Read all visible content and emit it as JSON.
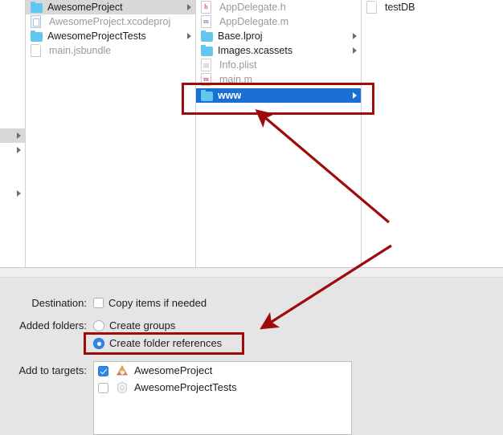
{
  "browser": {
    "columns": [
      {
        "name": "column-0",
        "rows": [
          {
            "label": "",
            "icon": "none",
            "selected": "gray",
            "has_arrow": true
          },
          {
            "label": "",
            "icon": "none",
            "selected": "none",
            "has_arrow": true
          },
          {
            "label": "",
            "icon": "none",
            "selected": "none",
            "has_arrow": false
          },
          {
            "label": "",
            "icon": "none",
            "selected": "none",
            "has_arrow": false
          },
          {
            "label": "",
            "icon": "none",
            "selected": "none",
            "has_arrow": true
          }
        ]
      },
      {
        "name": "column-1",
        "rows": [
          {
            "label": "AwesomeProject",
            "icon": "folder-icon",
            "selected": "gray",
            "has_arrow": true,
            "dim": false
          },
          {
            "label": "AwesomeProject.xcodeproj",
            "icon": "xcodeproj-icon",
            "selected": "none",
            "has_arrow": false,
            "dim": true
          },
          {
            "label": "AwesomeProjectTests",
            "icon": "folder-icon",
            "selected": "none",
            "has_arrow": true,
            "dim": false
          },
          {
            "label": "main.jsbundle",
            "icon": "document-icon",
            "selected": "none",
            "has_arrow": false,
            "dim": true
          }
        ]
      },
      {
        "name": "column-2",
        "rows": [
          {
            "label": "AppDelegate.h",
            "icon": "header-file-icon",
            "selected": "none",
            "has_arrow": false,
            "dim": true
          },
          {
            "label": "AppDelegate.m",
            "icon": "objc-file-icon",
            "selected": "none",
            "has_arrow": false,
            "dim": true
          },
          {
            "label": "Base.lproj",
            "icon": "folder-icon",
            "selected": "none",
            "has_arrow": true,
            "dim": false
          },
          {
            "label": "Images.xcassets",
            "icon": "folder-icon",
            "selected": "none",
            "has_arrow": true,
            "dim": false
          },
          {
            "label": "Info.plist",
            "icon": "plist-file-icon",
            "selected": "none",
            "has_arrow": false,
            "dim": true
          },
          {
            "label": "main.m",
            "icon": "objc-file-icon",
            "selected": "none",
            "has_arrow": false,
            "dim": true
          },
          {
            "label": "www",
            "icon": "folder-icon",
            "selected": "blue",
            "has_arrow": true,
            "dim": false
          }
        ]
      },
      {
        "name": "column-3",
        "rows": [
          {
            "label": "testDB",
            "icon": "document-icon",
            "selected": "none",
            "has_arrow": false,
            "dim": false
          }
        ]
      }
    ]
  },
  "panel": {
    "destination": {
      "label": "Destination:",
      "copy_items_label": "Copy items if needed",
      "copy_items_checked": false
    },
    "added_folders": {
      "label": "Added folders:",
      "options": [
        {
          "label": "Create groups",
          "selected": false
        },
        {
          "label": "Create folder references",
          "selected": true
        }
      ]
    },
    "add_to_targets": {
      "label": "Add to targets:",
      "targets": [
        {
          "label": "AwesomeProject",
          "checked": true,
          "icon": "app-target-icon"
        },
        {
          "label": "AwesomeProjectTests",
          "checked": false,
          "icon": "test-target-icon"
        }
      ]
    }
  },
  "annotations": {
    "highlight_color": "#9E0B0B",
    "selection_color": "#1A6FD4",
    "accent_color": "#2E8AE6",
    "boxes": [
      {
        "name": "www-row-highlight"
      },
      {
        "name": "create-folder-references-highlight"
      }
    ],
    "arrows": [
      {
        "name": "arrow-to-www-row"
      },
      {
        "name": "arrow-to-create-folder-references"
      }
    ]
  }
}
